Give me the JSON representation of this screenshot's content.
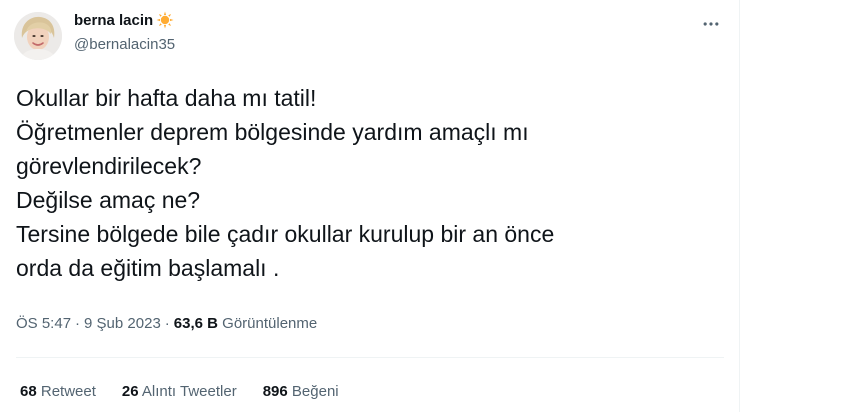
{
  "author": {
    "display_name": "berna lacin",
    "handle": "@bernalacin35",
    "avatar_icon": "profile-photo",
    "name_emoji_icon": "sun-emoji-icon"
  },
  "more_icon": "more-horizontal-icon",
  "tweet": {
    "lines": [
      "Okullar bir hafta daha mı tatil!",
      "Öğretmenler deprem bölgesinde yardım amaçlı mı",
      "görevlendirilecek?",
      "Değilse amaç ne?",
      "Tersine bölgede bile çadır okullar kurulup bir an önce",
      "orda da eğitim başlamalı ."
    ]
  },
  "meta": {
    "time": "ÖS 5:47",
    "separator": "·",
    "date": "9 Şub 2023",
    "views_count": "63,6 B",
    "views_label": "Görüntülenme"
  },
  "stats": {
    "retweets_count": "68",
    "retweets_label": "Retweet",
    "quotes_count": "26",
    "quotes_label": "Alıntı Tweetler",
    "likes_count": "896",
    "likes_label": "Beğeni"
  },
  "colors": {
    "text_primary": "#0f1419",
    "text_secondary": "#536471",
    "divider": "#eff3f4",
    "sun": "#ffac33"
  }
}
